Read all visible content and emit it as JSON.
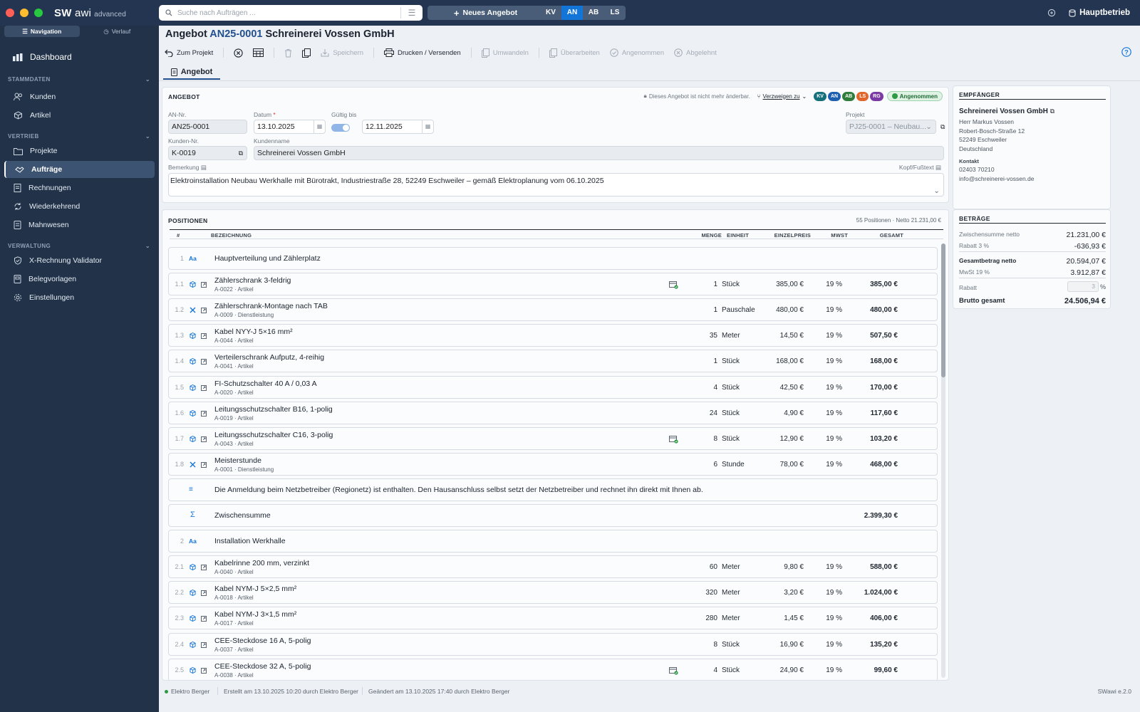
{
  "app": {
    "brand_bold": "SW",
    "brand_light": "awi",
    "brand_suffix": "advanced",
    "company": "Hauptbetrieb"
  },
  "search": {
    "placeholder": "Suche nach Aufträgen ..."
  },
  "new_offer": "Neues Angebot",
  "doc_types": [
    "KV",
    "AN",
    "AB",
    "LS"
  ],
  "sidebar": {
    "tabs": [
      "Navigation",
      "Verlauf"
    ],
    "dashboard": "Dashboard",
    "sections": [
      {
        "title": "STAMMDATEN",
        "items": [
          "Kunden",
          "Artikel"
        ]
      },
      {
        "title": "VERTRIEB",
        "items": [
          "Projekte",
          "Aufträge",
          "Rechnungen",
          "Wiederkehrend",
          "Mahnwesen"
        ]
      },
      {
        "title": "VERWALTUNG",
        "items": [
          "X-Rechnung Validator",
          "Belegvorlagen",
          "Einstellungen"
        ]
      }
    ]
  },
  "title": {
    "prefix": "Angebot",
    "number": "AN25-0001",
    "customer": "Schreinerei Vossen GmbH"
  },
  "toolbar": {
    "back": "Zum Projekt",
    "save": "Speichern",
    "print": "Drucken / Versenden",
    "convert": "Umwandeln",
    "revise": "Überarbeiten",
    "accepted": "Angenommen",
    "rejected": "Abgelehnt"
  },
  "doc_tab": "Angebot",
  "angebot": {
    "heading": "ANGEBOT",
    "locked_note": "Dieses Angebot ist nicht mehr änderbar.",
    "branch": "Verzweigen zu",
    "badges": [
      "KV",
      "AN",
      "AB",
      "LS",
      "RG"
    ],
    "status": "Angenommen",
    "labels": {
      "an_nr": "AN-Nr.",
      "datum": "Datum",
      "gueltig": "Gültig bis",
      "projekt": "Projekt",
      "kunden_nr": "Kunden-Nr.",
      "kundenname": "Kundenname",
      "bemerkung": "Bemerkung",
      "kopf": "Kopf/Fußtext"
    },
    "an_nr": "AN25-0001",
    "datum": "13.10.2025",
    "gueltig": "12.11.2025",
    "projekt": "PJ25-0001 – Neubau...",
    "kunden_nr": "K-0019",
    "kundenname": "Schreinerei Vossen GmbH",
    "bemerkung": "Elektroinstallation Neubau Werkhalle mit Bürotrakt, Industriestraße 28, 52249 Eschweiler – gemäß Elektroplanung vom 06.10.2025"
  },
  "positionen": {
    "heading": "POSITIONEN",
    "summary": "55 Positionen · Netto 21.231,00 €",
    "columns": {
      "nr": "#",
      "bez": "BEZEICHNUNG",
      "menge": "MENGE",
      "einheit": "EINHEIT",
      "ep": "EINZELPREIS",
      "mwst": "MWST",
      "gesamt": "GESAMT"
    },
    "rows": [
      {
        "kind": "heading",
        "num": "1",
        "name": "Hauptverteilung und Zählerplatz"
      },
      {
        "kind": "item",
        "type": "art",
        "num": "1.1",
        "name": "Zählerschrank 3-feldrig",
        "sub": "A-0022 · Artikel",
        "qty": "1",
        "unit": "Stück",
        "price": "385,00 €",
        "vat": "19 %",
        "total": "385,00 €",
        "flag": true
      },
      {
        "kind": "item",
        "type": "svc",
        "num": "1.2",
        "name": "Zählerschrank-Montage nach TAB",
        "sub": "A-0009 · Dienstleistung",
        "qty": "1",
        "unit": "Pauschale",
        "price": "480,00 €",
        "vat": "19 %",
        "total": "480,00 €"
      },
      {
        "kind": "item",
        "type": "art",
        "num": "1.3",
        "name": "Kabel NYY-J 5×16 mm²",
        "sub": "A-0044 · Artikel",
        "qty": "35",
        "unit": "Meter",
        "price": "14,50 €",
        "vat": "19 %",
        "total": "507,50 €"
      },
      {
        "kind": "item",
        "type": "art",
        "num": "1.4",
        "name": "Verteilerschrank Aufputz, 4-reihig",
        "sub": "A-0041 · Artikel",
        "qty": "1",
        "unit": "Stück",
        "price": "168,00 €",
        "vat": "19 %",
        "total": "168,00 €"
      },
      {
        "kind": "item",
        "type": "art",
        "num": "1.5",
        "name": "FI-Schutzschalter 40 A / 0,03 A",
        "sub": "A-0020 · Artikel",
        "qty": "4",
        "unit": "Stück",
        "price": "42,50 €",
        "vat": "19 %",
        "total": "170,00 €"
      },
      {
        "kind": "item",
        "type": "art",
        "num": "1.6",
        "name": "Leitungsschutzschalter B16, 1-polig",
        "sub": "A-0019 · Artikel",
        "qty": "24",
        "unit": "Stück",
        "price": "4,90 €",
        "vat": "19 %",
        "total": "117,60 €"
      },
      {
        "kind": "item",
        "type": "art",
        "num": "1.7",
        "name": "Leitungsschutzschalter C16, 3-polig",
        "sub": "A-0043 · Artikel",
        "qty": "8",
        "unit": "Stück",
        "price": "12,90 €",
        "vat": "19 %",
        "total": "103,20 €",
        "flag": true
      },
      {
        "kind": "item",
        "type": "svc",
        "num": "1.8",
        "name": "Meisterstunde",
        "sub": "A-0001 · Dienstleistung",
        "qty": "6",
        "unit": "Stunde",
        "price": "78,00 €",
        "vat": "19 %",
        "total": "468,00 €"
      },
      {
        "kind": "text",
        "name": "Die Anmeldung beim Netzbetreiber (Regionetz) ist enthalten. Den Hausanschluss selbst setzt der Netzbetreiber und rechnet ihn direkt mit Ihnen ab."
      },
      {
        "kind": "sum",
        "name": "Zwischensumme",
        "total": "2.399,30 €"
      },
      {
        "kind": "heading",
        "num": "2",
        "name": "Installation Werkhalle"
      },
      {
        "kind": "item",
        "type": "art",
        "num": "2.1",
        "name": "Kabelrinne 200 mm, verzinkt",
        "sub": "A-0040 · Artikel",
        "qty": "60",
        "unit": "Meter",
        "price": "9,80 €",
        "vat": "19 %",
        "total": "588,00 €"
      },
      {
        "kind": "item",
        "type": "art",
        "num": "2.2",
        "name": "Kabel NYM-J 5×2,5 mm²",
        "sub": "A-0018 · Artikel",
        "qty": "320",
        "unit": "Meter",
        "price": "3,20 €",
        "vat": "19 %",
        "total": "1.024,00 €"
      },
      {
        "kind": "item",
        "type": "art",
        "num": "2.3",
        "name": "Kabel NYM-J 3×1,5 mm²",
        "sub": "A-0017 · Artikel",
        "qty": "280",
        "unit": "Meter",
        "price": "1,45 €",
        "vat": "19 %",
        "total": "406,00 €"
      },
      {
        "kind": "item",
        "type": "art",
        "num": "2.4",
        "name": "CEE-Steckdose 16 A, 5-polig",
        "sub": "A-0037 · Artikel",
        "qty": "8",
        "unit": "Stück",
        "price": "16,90 €",
        "vat": "19 %",
        "total": "135,20 €"
      },
      {
        "kind": "item",
        "type": "art",
        "num": "2.5",
        "name": "CEE-Steckdose 32 A, 5-polig",
        "sub": "A-0038 · Artikel",
        "qty": "4",
        "unit": "Stück",
        "price": "24,90 €",
        "vat": "19 %",
        "total": "99,60 €",
        "flag": true
      }
    ]
  },
  "empfaenger": {
    "heading": "EMPFÄNGER",
    "name": "Schreinerei Vossen GmbH",
    "lines": [
      "Herr Markus Vossen",
      "Robert-Bosch-Straße 12",
      "52249 Eschweiler",
      "Deutschland"
    ],
    "kontakt_label": "Kontakt",
    "phone": "02403 70210",
    "email": "info@schreinerei-vossen.de"
  },
  "betraege": {
    "heading": "BETRÄGE",
    "rows": [
      {
        "label": "Zwischensumme netto",
        "value": "21.231,00 €"
      },
      {
        "label": "Rabatt 3 %",
        "value": "-636,93 €"
      },
      {
        "label": "Gesamtbetrag netto",
        "value": "20.594,07 €",
        "bold": true
      },
      {
        "label": "MwSt 19 %",
        "value": "3.912,87 €"
      }
    ],
    "rabatt_label": "Rabatt",
    "rabatt_value": "3",
    "rabatt_unit": "%",
    "brutto_label": "Brutto gesamt",
    "brutto_value": "24.506,94 €"
  },
  "status": {
    "user": "Elektro Berger",
    "created": "Erstellt am 13.10.2025 10:20 durch Elektro Berger",
    "changed": "Geändert am 13.10.2025 17:40 durch Elektro Berger",
    "version": "SWawi e.2.0"
  },
  "colors": {
    "accent": "#1475d8",
    "sidebar": "#213249",
    "topbar": "#233550",
    "kv": "#16707a",
    "an": "#1f5fb0",
    "ab": "#2f7d3a",
    "ls": "#e0662c",
    "rg": "#7b3aa3",
    "ok": "#2e9a46"
  }
}
